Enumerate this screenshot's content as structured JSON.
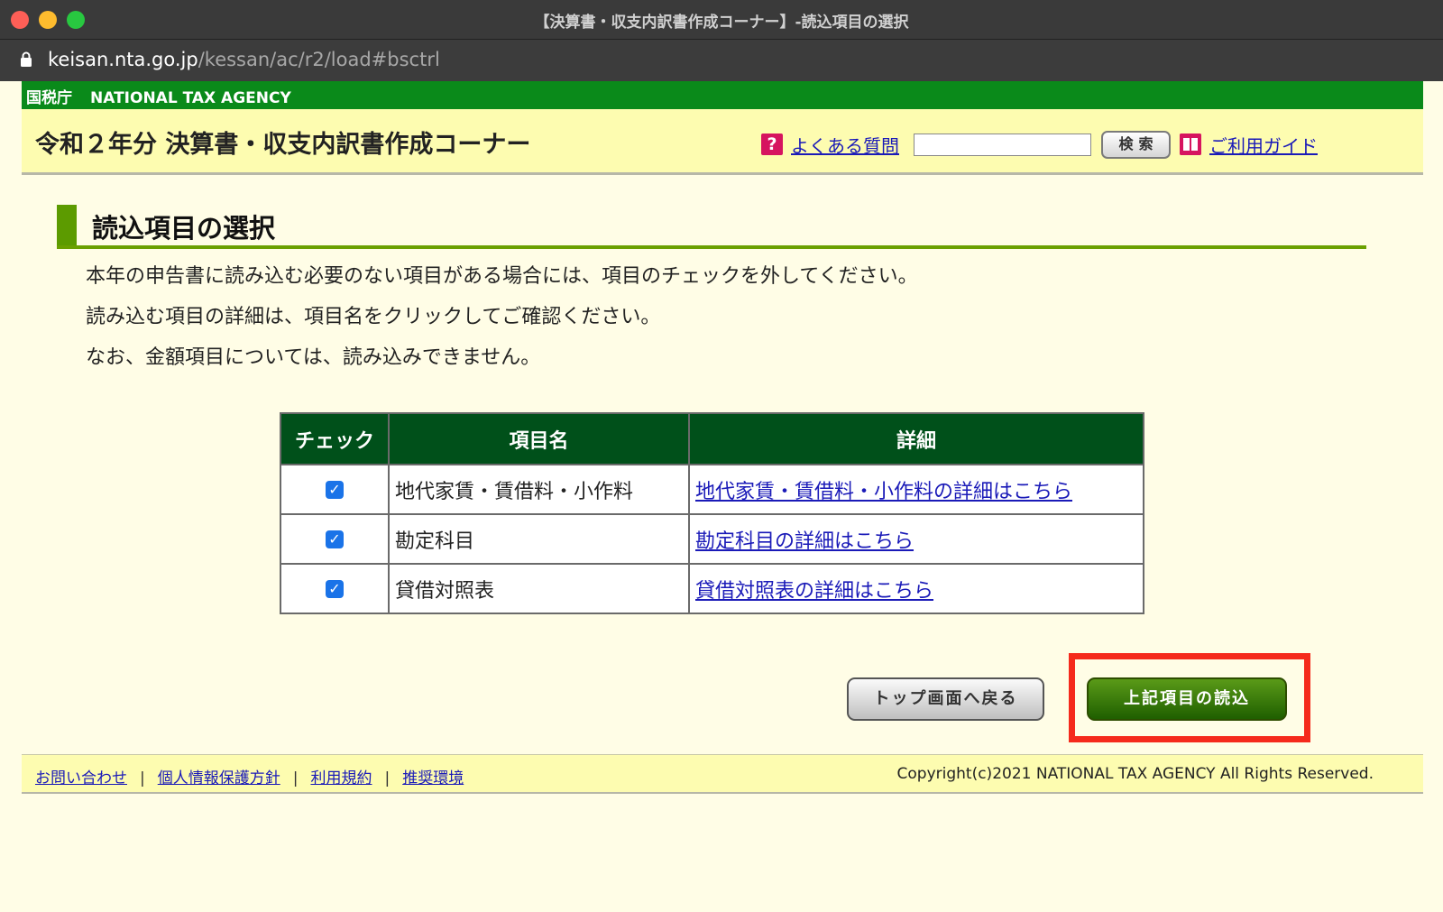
{
  "window": {
    "title": "【決算書・収支内訳書作成コーナー】-読込項目の選択",
    "url_host": "keisan.nta.go.jp",
    "url_path": "/kessan/ac/r2/load#bsctrl"
  },
  "agency": {
    "jp": "国税庁",
    "en": "NATIONAL TAX AGENCY"
  },
  "header": {
    "title": "令和２年分 決算書・収支内訳書作成コーナー",
    "faq_icon": "?",
    "faq_label": "よくある質問",
    "search_value": "",
    "search_button": "検索",
    "guide_label": "ご利用ガイド"
  },
  "section": {
    "title": "読込項目の選択",
    "instructions": [
      "本年の申告書に読み込む必要のない項目がある場合には、項目のチェックを外してください。",
      "読み込む項目の詳細は、項目名をクリックしてご確認ください。",
      "なお、金額項目については、読み込みできません。"
    ]
  },
  "table": {
    "headers": [
      "チェック",
      "項目名",
      "詳細"
    ],
    "rows": [
      {
        "checked": true,
        "name": "地代家賃・賃借料・小作料",
        "detail": "地代家賃・賃借料・小作料の詳細はこちら"
      },
      {
        "checked": true,
        "name": "勘定科目",
        "detail": "勘定科目の詳細はこちら"
      },
      {
        "checked": true,
        "name": "貸借対照表",
        "detail": "貸借対照表の詳細はこちら"
      }
    ]
  },
  "buttons": {
    "back": "トップ画面へ戻る",
    "load": "上記項目の読込"
  },
  "footer": {
    "links": [
      "お問い合わせ",
      "個人情報保護方針",
      "利用規約",
      "推奨環境"
    ],
    "separator": "|",
    "copyright": "Copyright(c)2021 NATIONAL TAX AGENCY All Rights Reserved."
  },
  "colors": {
    "agency_green": "#0a8a1a",
    "header_yellow": "#fdfcb0",
    "table_header": "#00501a",
    "highlight_red": "#f52a1c",
    "link_blue": "#1a1ab8"
  }
}
